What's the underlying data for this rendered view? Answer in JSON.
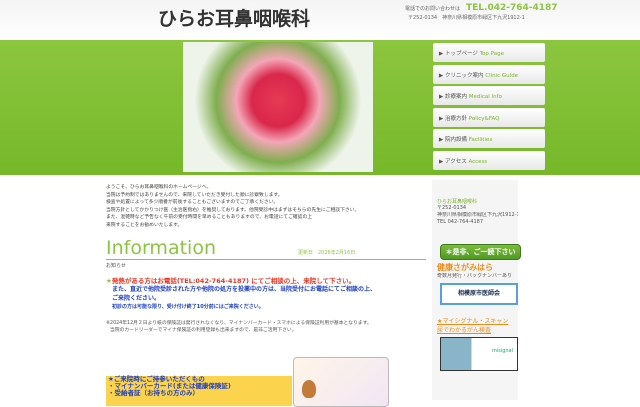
{
  "header": {
    "logo": "ひらお耳鼻咽喉科",
    "contact_label": "電話でのお問い合わせは",
    "tel": "TEL.042-764-4187",
    "address": "〒252-0134　神奈川県相模原市緑区下九沢1912-1"
  },
  "nav": [
    {
      "jp": "▶ トップページ",
      "en": "Top Page"
    },
    {
      "jp": "▶ クリニック案内",
      "en": "Clinic Guide"
    },
    {
      "jp": "▶ 診療案内",
      "en": "Medical Info"
    },
    {
      "jp": "▶ 治療方針",
      "en": "Policy&FAQ"
    },
    {
      "jp": "▶ 院内設備",
      "en": "Facilities"
    },
    {
      "jp": "▶ アクセス",
      "en": "Access"
    }
  ],
  "intro": [
    "ようこそ、ひらお耳鼻咽喉科のホームページへ。",
    "当院は予約制ではありませんので、来院していただき受付した順に診察致します。",
    "検査や処置によって多少順番が前後することもございますのでご了承ください。",
    "当院方針としてかかりつけ医（主治医指右）を推奨しております。他院受診中はまずはそちらの先生にご相談下さい。",
    "また、混雑時など予告なく午前の受付時間を早めることもありますので、お電話にてご確認の上",
    "来院することをお勧めいたします。"
  ],
  "info": {
    "title": "Information",
    "updated": "更新日　2026年2月16日",
    "subtitle": "お知らせ",
    "star": "★",
    "fever": "発熱がある方はお電話(TEL:042-764-4187) にてご相談の上、来院して下さい。",
    "blue1": "また、直近で他院受診された方や他院の処方を投薬中の方は、当院受付にお電話にてご相談の上、",
    "blue2": "ご来院ください。",
    "blue3": "初診の方は可能な限り、受け付け終了10分前にはご来院ください。",
    "note1": "※2024年12月２日より紙の保険証は発行されなくなり、マイナンバーカード・スマホによる保険証利用が基本となります。",
    "note2": "当院のカードリーダーでマイナ保険証の利用登録も出来ますので、是非ご活用下さい。"
  },
  "bring": [
    "★ご来院時にご持参いただくもの",
    "・マイナンバーカード(または健康保険証)",
    "・受給者証（お持ちの方のみ）"
  ],
  "side": {
    "clinic": "ひらお耳鼻咽喉科",
    "zip": "〒252-0134",
    "addr": "神奈川県相模原市緑区下九沢1912-1",
    "tel": "TEL 042-764-4187",
    "visit": "＊是非、ご一読下さい",
    "kenko": "健康さがみはら",
    "kenko_sub": "奇数月発行・バックナンバーあり",
    "banner": "相模原市医師会",
    "link1": "★マイシグナル・スキャン",
    "link2": "尿でわかるがん検査",
    "banner2": "misignal"
  }
}
